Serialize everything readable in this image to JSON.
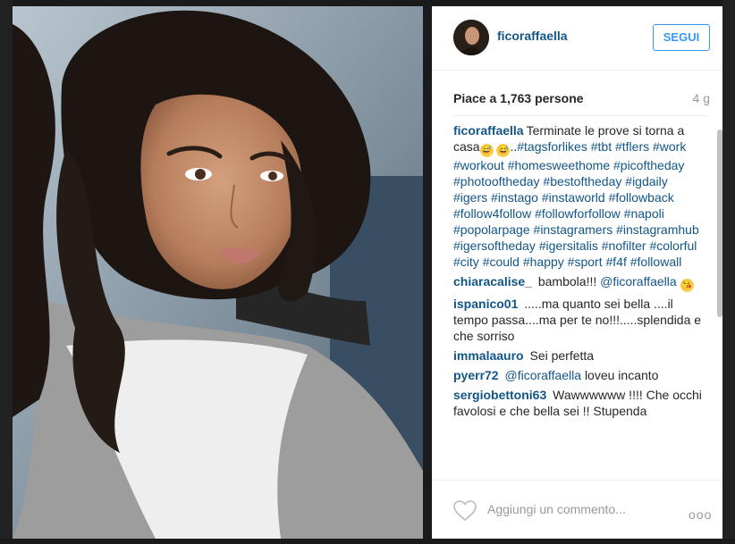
{
  "post": {
    "username": "ficoraffaella",
    "follow_label": "SEGUI",
    "likes_text": "Piace a 1,763 persone",
    "time_ago": "4 g"
  },
  "caption": {
    "author": "ficoraffaella",
    "text_before": "Terminate le prove si torna a casa",
    "emoji1": "😅",
    "emoji2": "😅",
    "dots": "..",
    "hashtags": [
      "#tagsforlikes",
      "#tbt",
      "#tflers",
      "#work",
      "#workout",
      "#homesweethome",
      "#picoftheday",
      "#photooftheday",
      "#bestoftheday",
      "#igdaily",
      "#igers",
      "#instago",
      "#instaworld",
      "#followback",
      "#follow4follow",
      "#followforfollow",
      "#napoli",
      "#popolarpage",
      "#instagramers",
      "#instagramhub",
      "#igersoftheday",
      "#igersitalis",
      "#nofilter",
      "#colorful",
      "#city",
      "#could",
      "#happy",
      "#sport",
      "#f4f",
      "#followall"
    ]
  },
  "comments": [
    {
      "author": "chiaracalise_",
      "text": "bambola!!!",
      "mention": "@ficoraffaella",
      "emoji": "😘"
    },
    {
      "author": "ispanico01",
      "text": ".....ma quanto sei bella ....il tempo passa....ma per te no!!!.....splendida e che sorriso"
    },
    {
      "author": "immalaauro",
      "text": "Sei perfetta"
    },
    {
      "author": "pyerr72",
      "mention": "@ficoraffaella",
      "text": "loveu incanto"
    },
    {
      "author": "sergiobettoni63",
      "text": "Wawwwwww !!!! Che occhi favolosi e che bella sei !! Stupenda"
    }
  ],
  "footer": {
    "comment_placeholder": "Aggiungi un commento...",
    "more_label": "ooo"
  },
  "colors": {
    "username_blue": "#125688",
    "follow_blue": "#3897f0"
  },
  "icons": [
    "heart-icon",
    "more-options-icon"
  ]
}
